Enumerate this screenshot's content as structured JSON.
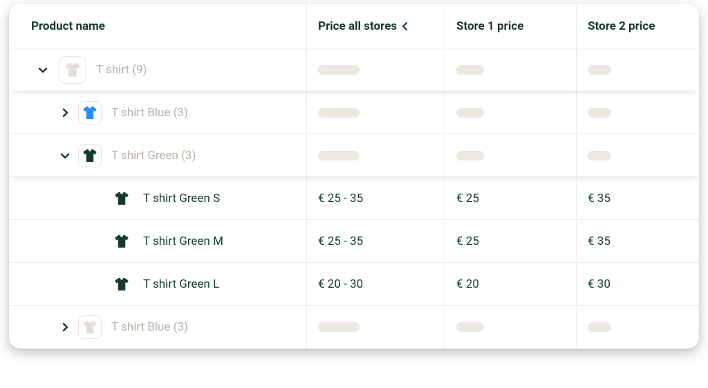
{
  "columns": {
    "name": "Product name",
    "priceAll": "Price all stores",
    "store1": "Store 1 price",
    "store2": "Store 2 price"
  },
  "rows": [
    {
      "level": 0,
      "expanded": true,
      "icon": "tshirt",
      "iconColor": "#e4ded6",
      "label": "T shirt (9)",
      "muted": true,
      "priceAll": "",
      "store1": "",
      "store2": "",
      "drop": true
    },
    {
      "level": 1,
      "expanded": false,
      "icon": "tshirt",
      "iconColor": "#2a8ff2",
      "label": "T shirt Blue (3)",
      "muted": true,
      "priceAll": "",
      "store1": "",
      "store2": ""
    },
    {
      "level": 1,
      "expanded": true,
      "icon": "tshirt",
      "iconColor": "#163a2e",
      "label": "T shirt Green (3)",
      "muted": true,
      "priceAll": "",
      "store1": "",
      "store2": "",
      "drop": true
    },
    {
      "level": 2,
      "icon": "tshirt",
      "iconColor": "#163a2e",
      "label": "T shirt Green S",
      "muted": false,
      "priceAll": "€ 25 - 35",
      "store1": "€ 25",
      "store2": "€ 35"
    },
    {
      "level": 2,
      "icon": "tshirt",
      "iconColor": "#163a2e",
      "label": "T shirt Green M",
      "muted": false,
      "priceAll": "€ 25 - 35",
      "store1": "€ 25",
      "store2": "€ 35"
    },
    {
      "level": 2,
      "icon": "tshirt",
      "iconColor": "#163a2e",
      "label": "T shirt Green L",
      "muted": false,
      "priceAll": "€ 20 - 30",
      "store1": "€ 20",
      "store2": "€ 30"
    },
    {
      "level": 1,
      "expanded": false,
      "icon": "tshirt",
      "iconColor": "#e4ded6",
      "label": "T shirt Blue (3)",
      "muted": true,
      "priceAll": "",
      "store1": "",
      "store2": ""
    }
  ]
}
